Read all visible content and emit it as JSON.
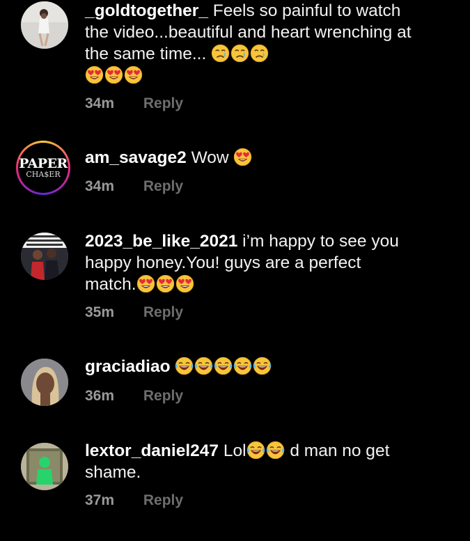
{
  "comments": [
    {
      "username": "_goldtogether_",
      "text": "Feels so painful to watch the video...beautiful and heart wrenching at the same time...",
      "emojis": [
        "crying-face",
        "crying-face",
        "crying-face",
        "heart-eyes",
        "heart-eyes",
        "heart-eyes"
      ],
      "time": "34m",
      "reply": "Reply"
    },
    {
      "username": "am_savage2",
      "text": "Wow",
      "emojis": [
        "heart-eyes"
      ],
      "time": "34m",
      "reply": "Reply",
      "avatar_top": "PAPER",
      "avatar_bottom": "CHA$ER"
    },
    {
      "username": "2023_be_like_2021",
      "text": "i’m happy to see you happy honey.You! guys are a perfect match.",
      "emojis": [
        "heart-eyes",
        "heart-eyes",
        "heart-eyes"
      ],
      "time": "35m",
      "reply": "Reply"
    },
    {
      "username": "graciadiao",
      "text": "",
      "emojis": [
        "laughing-tears",
        "laughing-tears",
        "laughing-tears",
        "laughing-tears",
        "laughing-tears"
      ],
      "time": "36m",
      "reply": "Reply"
    },
    {
      "username": "lextor_daniel247",
      "text_before": "Lol",
      "text_after": " d man no get shame.",
      "emojis": [
        "laughing-tears",
        "laughing-tears"
      ],
      "time": "37m",
      "reply": "Reply"
    }
  ],
  "colors": {
    "background": "#000000",
    "text": "#f2f2f2",
    "time": "#9a9a9a",
    "reply": "#6e6e6e",
    "emoji_face": "#f7c53b"
  }
}
